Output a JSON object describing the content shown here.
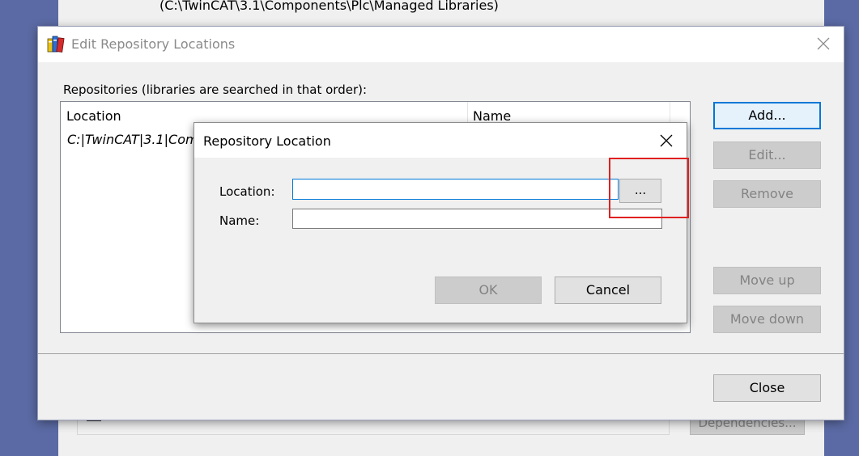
{
  "background_window": {
    "path_text": "(C:\\TwinCAT\\3.1\\Components\\Plc\\Managed Libraries)",
    "dependencies_label": "Dependencies..."
  },
  "edit_repository_locations": {
    "title": "Edit Repository Locations",
    "list_caption": "Repositories (libraries are searched in that order):",
    "columns": {
      "location": "Location",
      "name": "Name"
    },
    "rows": [
      {
        "location": "C:|TwinCAT|3.1|Com"
      }
    ],
    "buttons": {
      "add": "Add...",
      "edit": "Edit...",
      "remove": "Remove",
      "move_up": "Move up",
      "move_down": "Move down",
      "close": "Close"
    }
  },
  "repository_location_dialog": {
    "title": "Repository Location",
    "location_label": "Location:",
    "name_label": "Name:",
    "location_value": "",
    "name_value": "",
    "browse_label": "...",
    "ok_label": "OK",
    "cancel_label": "Cancel"
  },
  "colors": {
    "desktop": "#5b6aa4",
    "dialog_bg": "#f0f0f0",
    "focus_blue": "#0078d7",
    "highlight_red": "#e02020"
  },
  "icons": {
    "app_icon": "library-books-icon",
    "close": "close-icon"
  }
}
